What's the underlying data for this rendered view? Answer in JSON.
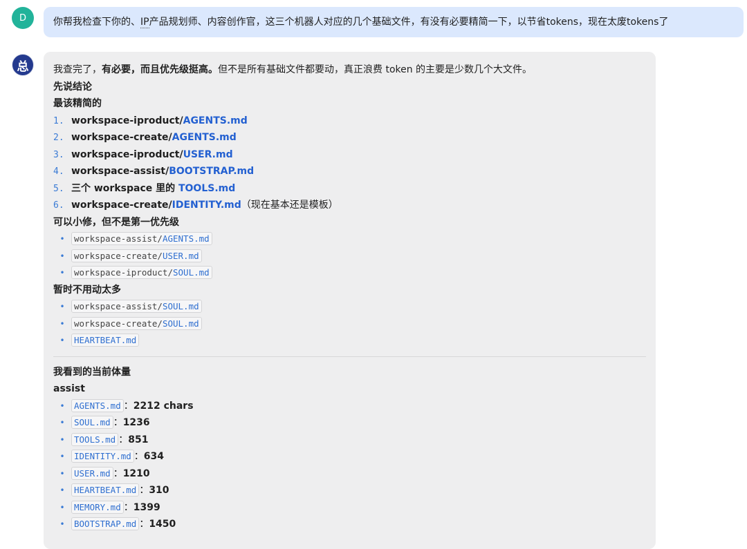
{
  "user": {
    "avatar_letter": "D",
    "message_before": "你帮我检查下你的、",
    "message_abbr": "IP",
    "message_after": "产品规划师、内容创作官，这三个机器人对应的几个基础文件，有没有必要精简一下，以节省tokens，现在太废tokens了"
  },
  "bot": {
    "avatar_char": "总",
    "intro": {
      "pre": "我查完了，",
      "bold": "有必要，而且优先级挺高。",
      "post": "但不是所有基础文件都要动，真正浪费 token 的主要是少数几个大文件。"
    },
    "conclusion_heading": "先说结论",
    "priority_heading": "最该精简的",
    "priority_items": [
      {
        "num": "1.",
        "prefix": "workspace-iproduct/",
        "file": "AGENTS.md",
        "note": ""
      },
      {
        "num": "2.",
        "prefix": "workspace-create/",
        "file": "AGENTS.md",
        "note": ""
      },
      {
        "num": "3.",
        "prefix": "workspace-iproduct/",
        "file": "USER.md",
        "note": ""
      },
      {
        "num": "4.",
        "prefix": "workspace-assist/",
        "file": "BOOTSTRAP.md",
        "note": ""
      },
      {
        "num": "5.",
        "prefix": "三个 workspace 里的 ",
        "file": "TOOLS.md",
        "note": ""
      },
      {
        "num": "6.",
        "prefix": "workspace-create/",
        "file": "IDENTITY.md",
        "note": "（现在基本还是模板）"
      }
    ],
    "minor_heading": "可以小修，但不是第一优先级",
    "minor_items": [
      {
        "prefix": "workspace-assist/",
        "file": "AGENTS.md"
      },
      {
        "prefix": "workspace-create/",
        "file": "USER.md"
      },
      {
        "prefix": "workspace-iproduct/",
        "file": "SOUL.md"
      }
    ],
    "skip_heading": "暂时不用动太多",
    "skip_items": [
      {
        "prefix": "workspace-assist/",
        "file": "SOUL.md"
      },
      {
        "prefix": "workspace-create/",
        "file": "SOUL.md"
      },
      {
        "prefix": "",
        "file": "HEARTBEAT.md"
      }
    ],
    "volume_heading": "我看到的当前体量",
    "volume_group": "assist",
    "volume_items": [
      {
        "file": "AGENTS.md",
        "value": "2212 chars"
      },
      {
        "file": "SOUL.md",
        "value": "1236"
      },
      {
        "file": "TOOLS.md",
        "value": "851"
      },
      {
        "file": "IDENTITY.md",
        "value": "634"
      },
      {
        "file": "USER.md",
        "value": "1210"
      },
      {
        "file": "HEARTBEAT.md",
        "value": "310"
      },
      {
        "file": "MEMORY.md",
        "value": "1399"
      },
      {
        "file": "BOOTSTRAP.md",
        "value": "1450"
      }
    ]
  },
  "colors": {
    "user_bubble": "#dbe8fd",
    "bot_bubble": "#eeeeef",
    "link": "#2360d1",
    "user_avatar": "#22b39a",
    "bot_avatar": "#243a8e"
  }
}
